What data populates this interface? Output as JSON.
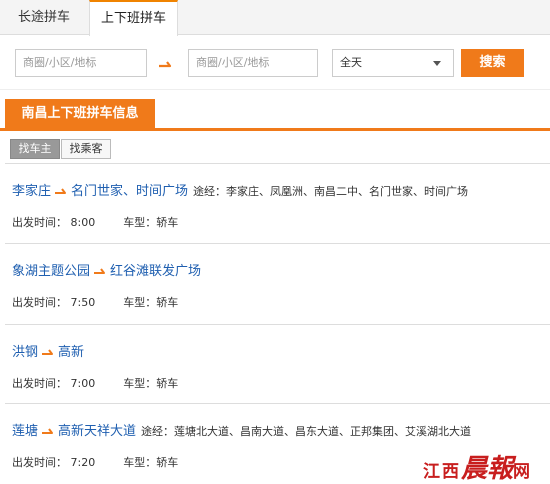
{
  "tabs": [
    {
      "label": "长途拼车",
      "active": false
    },
    {
      "label": "上下班拼车",
      "active": true
    }
  ],
  "search": {
    "from_placeholder": "商圈/小区/地标",
    "to_placeholder": "商圈/小区/地标",
    "time_value": "全天",
    "button_label": "搜索"
  },
  "section": {
    "title": "南昌上下班拼车信息"
  },
  "filters": {
    "owner": "找车主",
    "passenger": "找乘客"
  },
  "listings": [
    {
      "from": "李家庄",
      "to": "名门世家、时间广场",
      "via": "途经：李家庄、凤凰洲、南昌二中、名门世家、时间广场",
      "depart": "出发时间： 8:00",
      "car": "车型：轿车"
    },
    {
      "from": "象湖主题公园",
      "to": "红谷滩联发广场",
      "via": "",
      "depart": "出发时间： 7:50",
      "car": "车型：轿车"
    },
    {
      "from": "洪钢",
      "to": "高新",
      "via": "",
      "depart": "出发时间： 7:00",
      "car": "车型：轿车"
    },
    {
      "from": "莲塘",
      "to": "高新天祥大道",
      "via": "途经：莲塘北大道、昌南大道、昌东大道、正邦集团、艾溪湖北大道",
      "depart": "出发时间： 7:20",
      "car": "车型：轿车"
    }
  ],
  "watermark": {
    "small": "江西",
    "big": "晨報",
    "tail": "网"
  },
  "colors": {
    "accent": "#f07a1a",
    "link": "#1f5fb0",
    "watermark": "#c81e1e"
  },
  "icons": {
    "route_arrow": "arrow-right-icon",
    "dropdown": "chevron-down-icon"
  }
}
